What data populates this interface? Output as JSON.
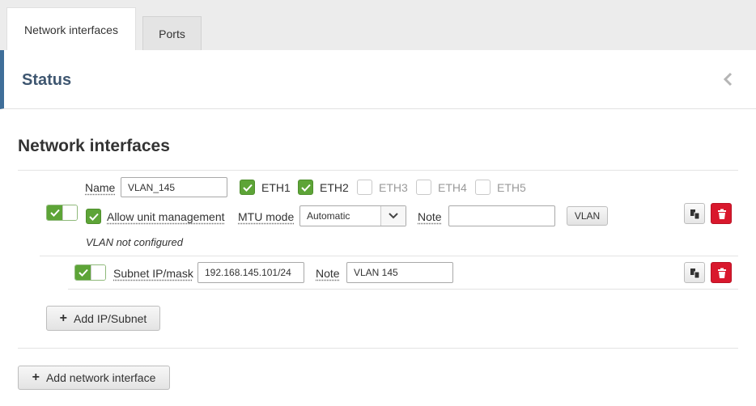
{
  "tabs": [
    {
      "label": "Network interfaces",
      "active": true
    },
    {
      "label": "Ports",
      "active": false
    }
  ],
  "status": {
    "title": "Status"
  },
  "section": {
    "title": "Network interfaces"
  },
  "interface": {
    "enabled": true,
    "name_label": "Name",
    "name_value": "VLAN_145",
    "ports": [
      {
        "label": "ETH1",
        "checked": true
      },
      {
        "label": "ETH2",
        "checked": true
      },
      {
        "label": "ETH3",
        "checked": false
      },
      {
        "label": "ETH4",
        "checked": false
      },
      {
        "label": "ETH5",
        "checked": false
      }
    ],
    "allow_mgmt_label": "Allow unit management",
    "allow_mgmt_checked": true,
    "mtu_label": "MTU mode",
    "mtu_value": "Automatic",
    "note_label": "Note",
    "note_value": "",
    "vlan_button": "VLAN",
    "vlan_status": "VLAN not configured"
  },
  "subnet": {
    "enabled": true,
    "ip_label": "Subnet IP/mask",
    "ip_value": "192.168.145.101/24",
    "note_label": "Note",
    "note_value": "VLAN 145"
  },
  "buttons": {
    "add_subnet": "Add IP/Subnet",
    "add_interface": "Add network interface"
  },
  "colors": {
    "accent": "#3f6e99",
    "check_green": "#5da437",
    "delete_red": "#d9182d"
  },
  "icons": {
    "copy": "copy-icon",
    "delete": "trash-icon",
    "collapse": "chevron-left-icon",
    "add": "plus-icon"
  }
}
